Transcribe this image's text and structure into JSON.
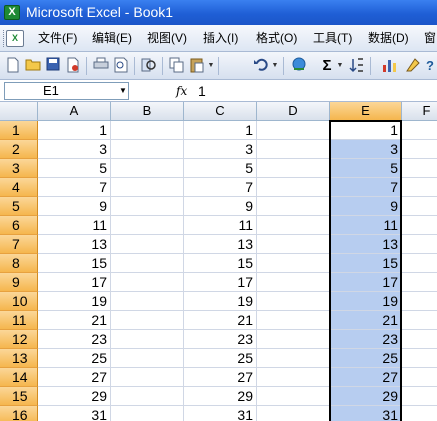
{
  "window": {
    "title": "Microsoft Excel - Book1",
    "app_icon_glyph": "X"
  },
  "menubar": {
    "doc_icon_glyph": "X",
    "items": [
      {
        "label": "文件(F)"
      },
      {
        "label": "编辑(E)"
      },
      {
        "label": "视图(V)"
      },
      {
        "label": "插入(I)"
      },
      {
        "label": "格式(O)"
      },
      {
        "label": "工具(T)"
      },
      {
        "label": "数据(D)"
      },
      {
        "label": "窗"
      }
    ]
  },
  "toolbar": {
    "icons": [
      "new-icon",
      "open-icon",
      "save-icon",
      "permission-icon",
      "print-icon",
      "print-preview-icon",
      "research-icon",
      "copy-icon",
      "paste-icon",
      "undo-icon",
      "hyperlink-icon",
      "autosum-icon",
      "sort-ascending-icon",
      "chart-wizard-icon",
      "help-icon"
    ],
    "autosum_glyph": "Σ",
    "help_glyph": "?"
  },
  "formula_bar": {
    "name_box": "E1",
    "fx_label": "fx",
    "formula": "1"
  },
  "sheet": {
    "columns": [
      "A",
      "B",
      "C",
      "D",
      "E",
      "F"
    ],
    "selected_column": "E",
    "active_cell": "E1",
    "rows": [
      {
        "row": "1",
        "A": "1",
        "B": "",
        "C": "1",
        "D": "",
        "E": "1"
      },
      {
        "row": "2",
        "A": "3",
        "B": "",
        "C": "3",
        "D": "",
        "E": "3"
      },
      {
        "row": "3",
        "A": "5",
        "B": "",
        "C": "5",
        "D": "",
        "E": "5"
      },
      {
        "row": "4",
        "A": "7",
        "B": "",
        "C": "7",
        "D": "",
        "E": "7"
      },
      {
        "row": "5",
        "A": "9",
        "B": "",
        "C": "9",
        "D": "",
        "E": "9"
      },
      {
        "row": "6",
        "A": "11",
        "B": "",
        "C": "11",
        "D": "",
        "E": "11"
      },
      {
        "row": "7",
        "A": "13",
        "B": "",
        "C": "13",
        "D": "",
        "E": "13"
      },
      {
        "row": "8",
        "A": "15",
        "B": "",
        "C": "15",
        "D": "",
        "E": "15"
      },
      {
        "row": "9",
        "A": "17",
        "B": "",
        "C": "17",
        "D": "",
        "E": "17"
      },
      {
        "row": "10",
        "A": "19",
        "B": "",
        "C": "19",
        "D": "",
        "E": "19"
      },
      {
        "row": "11",
        "A": "21",
        "B": "",
        "C": "21",
        "D": "",
        "E": "21"
      },
      {
        "row": "12",
        "A": "23",
        "B": "",
        "C": "23",
        "D": "",
        "E": "23"
      },
      {
        "row": "13",
        "A": "25",
        "B": "",
        "C": "25",
        "D": "",
        "E": "25"
      },
      {
        "row": "14",
        "A": "27",
        "B": "",
        "C": "27",
        "D": "",
        "E": "27"
      },
      {
        "row": "15",
        "A": "29",
        "B": "",
        "C": "29",
        "D": "",
        "E": "29"
      },
      {
        "row": "16",
        "A": "31",
        "B": "",
        "C": "31",
        "D": "",
        "E": "31"
      }
    ]
  },
  "colors": {
    "title_bar": "#1f5fd6",
    "selection_fill": "#b7cdf0",
    "header_highlight": "#f5b64e"
  }
}
